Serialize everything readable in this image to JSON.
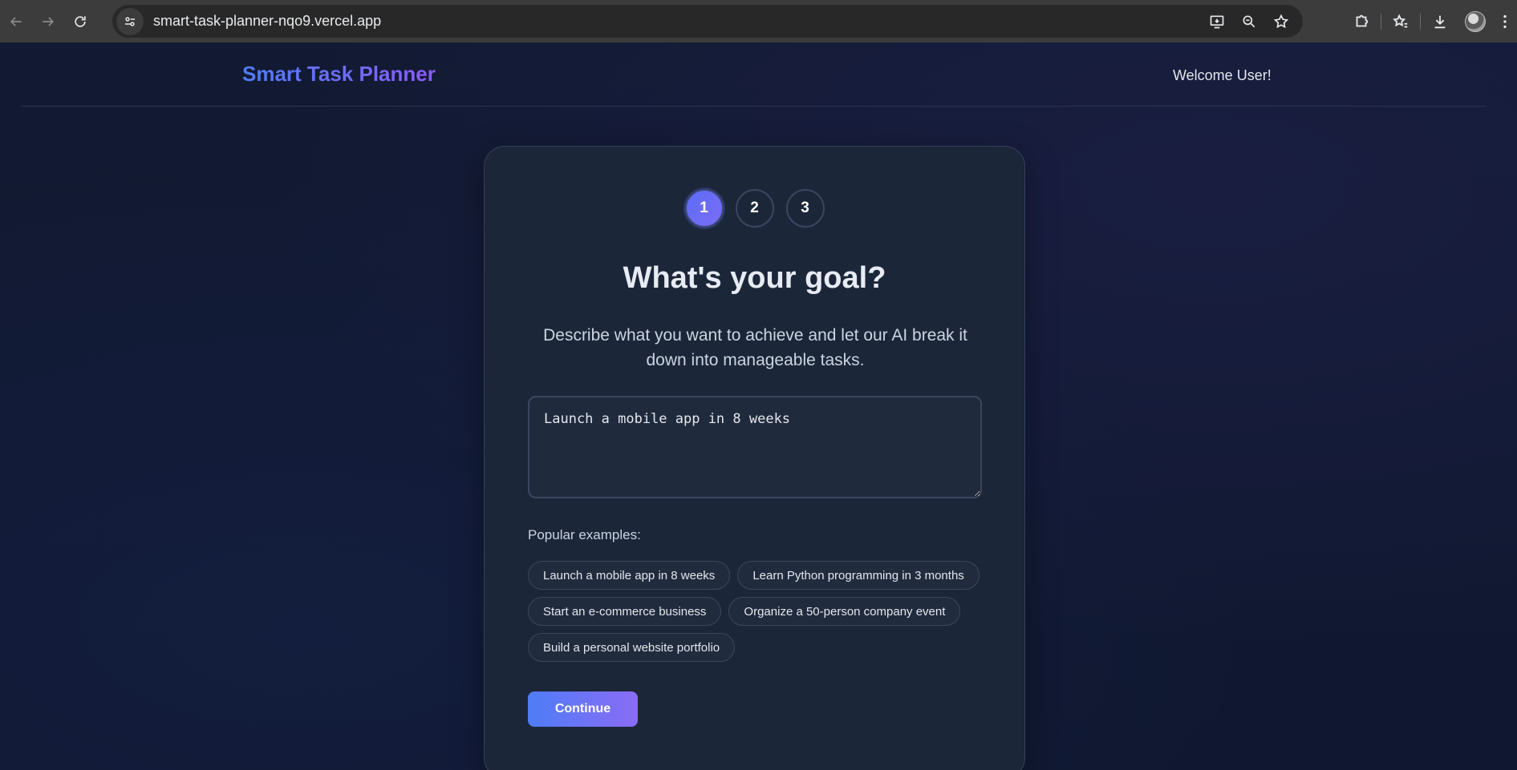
{
  "browser": {
    "url": "smart-task-planner-nqo9.vercel.app",
    "icons": {
      "back": "back-arrow-icon",
      "forward": "forward-arrow-icon",
      "reload": "reload-icon",
      "site_info": "tune-icon",
      "install": "install-app-icon",
      "zoom": "zoom-out-icon",
      "bookmark": "star-icon",
      "extensions": "puzzle-icon",
      "bookmarks_panel": "star-list-icon",
      "downloads": "download-icon",
      "profile": "avatar",
      "menu": "more-vert-icon"
    }
  },
  "header": {
    "brand": "Smart Task Planner",
    "welcome": "Welcome User!"
  },
  "stepper": {
    "steps": [
      "1",
      "2",
      "3"
    ],
    "active_index": 0
  },
  "main": {
    "title": "What's your goal?",
    "subtitle": "Describe what you want to achieve and let our AI break it down into manageable tasks.",
    "goal_value": "Launch a mobile app in 8 weeks",
    "examples_label": "Popular examples:",
    "examples": [
      "Launch a mobile app in 8 weeks",
      "Learn Python programming in 3 months",
      "Start an e-commerce business",
      "Organize a 50-person company event",
      "Build a personal website portfolio"
    ],
    "continue_label": "Continue"
  },
  "colors": {
    "accent_start": "#4f7cf6",
    "accent_end": "#8b5cf6",
    "background": "#101831",
    "card": "#1c2639"
  }
}
